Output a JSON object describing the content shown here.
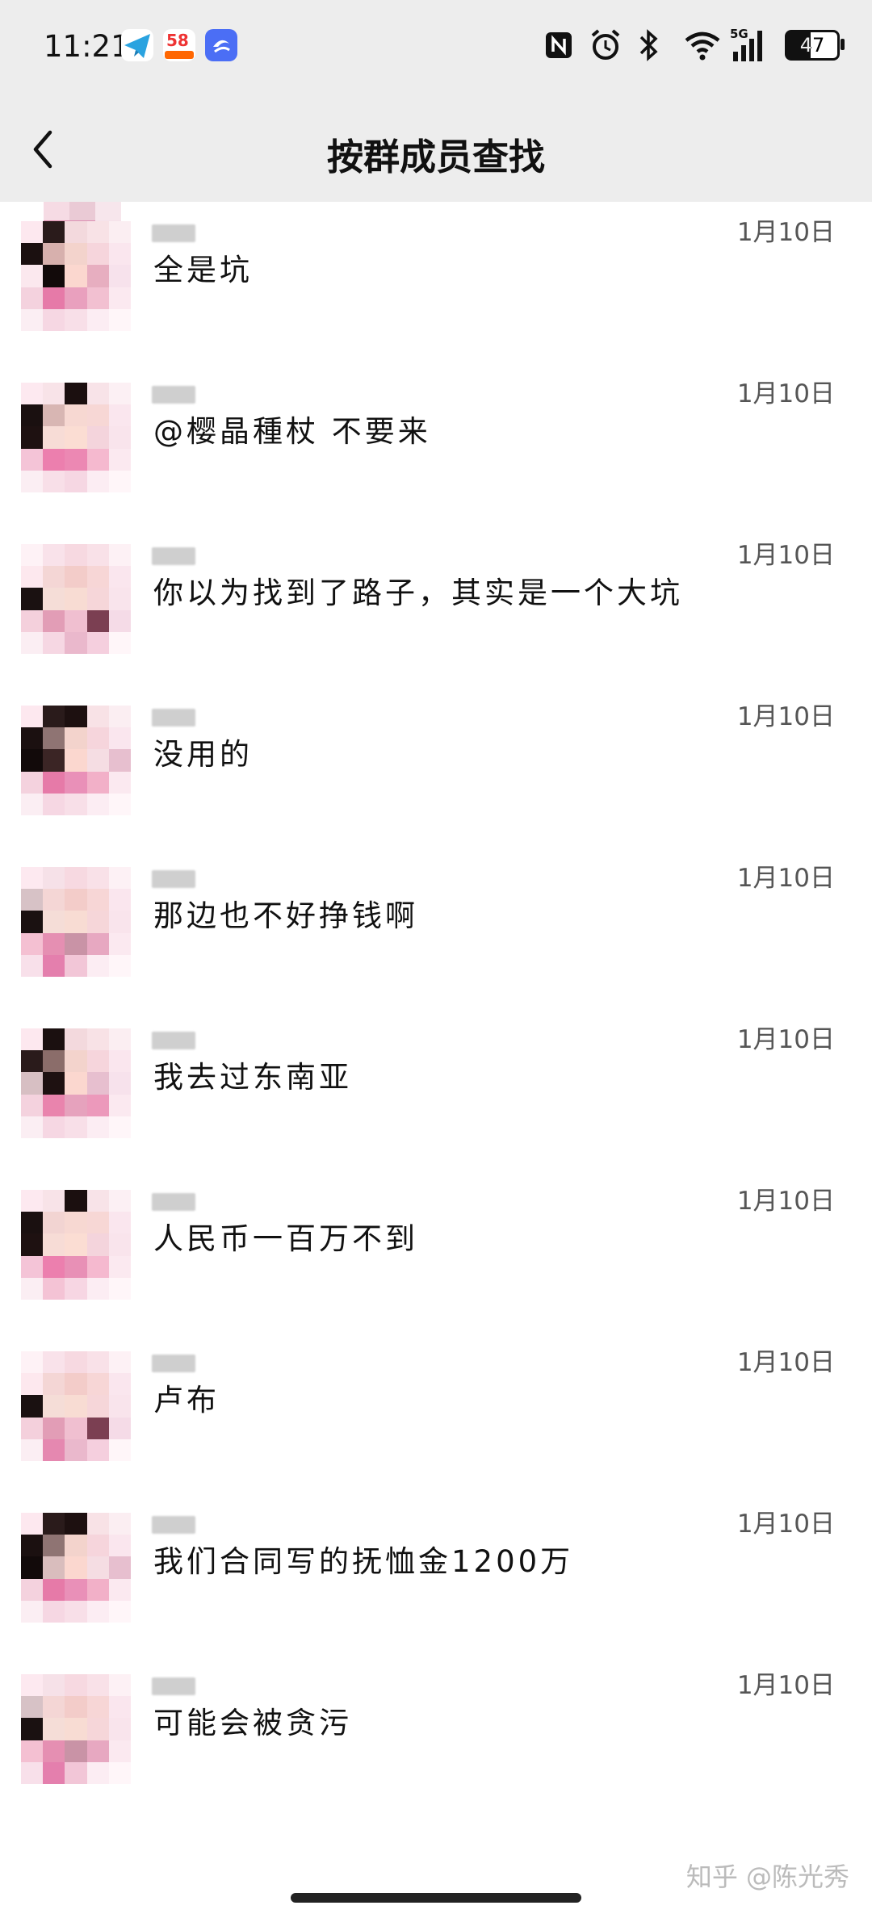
{
  "status_bar": {
    "time": "11:21",
    "app_58_label": "58",
    "battery_level": "47",
    "network": "5G"
  },
  "header": {
    "title": "按群成员查找",
    "back_icon": "chevron-left-icon"
  },
  "messages": [
    {
      "text": "全是坑",
      "date": "1月10日"
    },
    {
      "text": "@樱晶種杖 不要来",
      "date": "1月10日"
    },
    {
      "text": "你以为找到了路子，其实是一个大坑",
      "date": "1月10日"
    },
    {
      "text": "没用的",
      "date": "1月10日"
    },
    {
      "text": "那边也不好挣钱啊",
      "date": "1月10日"
    },
    {
      "text": "我去过东南亚",
      "date": "1月10日"
    },
    {
      "text": "人民币一百万不到",
      "date": "1月10日"
    },
    {
      "text": "卢布",
      "date": "1月10日"
    },
    {
      "text": "我们合同写的抚恤金1200万",
      "date": "1月10日"
    },
    {
      "text": "可能会被贪污",
      "date": "1月10日"
    }
  ],
  "watermark": "知乎 @陈光秀",
  "colors": {
    "bar_bg": "#ededed",
    "avatar_pink": "#f0a0c0",
    "avatar_dark": "#2a1a1a"
  }
}
